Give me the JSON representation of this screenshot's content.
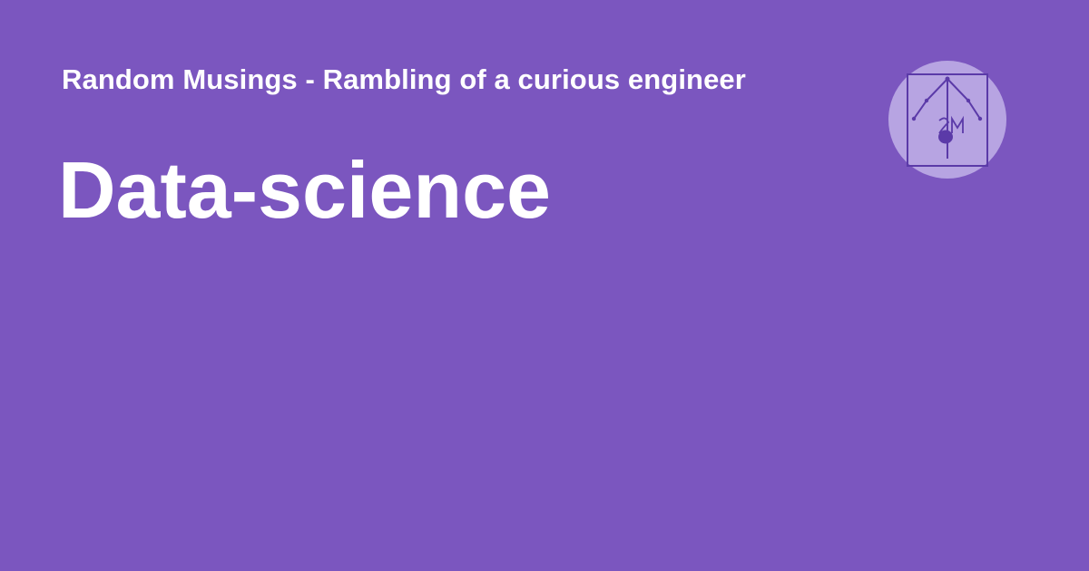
{
  "header": {
    "site_title": "Random Musings - Rambling of a curious engineer",
    "logo_icon": "site-logo-icon"
  },
  "main": {
    "heading": "Data-science"
  },
  "colors": {
    "background": "#7b56bf",
    "text": "#ffffff",
    "logo_circle": "#b7a4e2",
    "logo_stroke": "#5b3aa8"
  }
}
